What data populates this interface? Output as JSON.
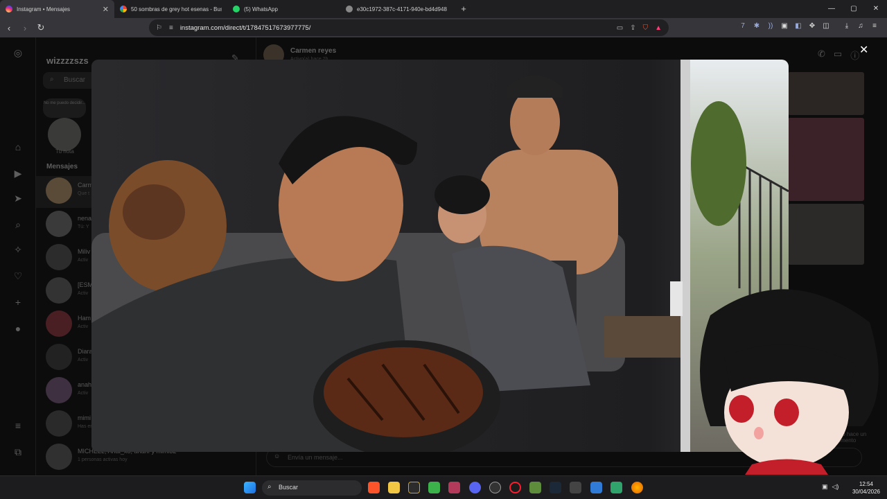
{
  "browser": {
    "tabs": [
      {
        "label": "Instagram • Mensajes",
        "icon": "instagram-icon",
        "active": true
      },
      {
        "label": "50 sombras de grey hot esenas - Bus",
        "icon": "google-icon"
      },
      {
        "label": "(5) WhatsApp",
        "icon": "whatsapp-icon"
      },
      {
        "label": "e30c1972-387c-4171-940e-bd4d948",
        "icon": "globe-icon"
      }
    ],
    "url": "instagram.com/direct/t/17847517673977775/"
  },
  "instagram": {
    "username": "wizzzzszs",
    "search_placeholder": "Buscar",
    "note_text": "No me puedo decidir...",
    "note_label": "Tu nota",
    "messages_header": "Mensajes",
    "conversations": [
      {
        "name": "Carm",
        "status": "Que t"
      },
      {
        "name": "nena",
        "status": "Tú: Y"
      },
      {
        "name": "Miliv",
        "status": "Activ"
      },
      {
        "name": "[ESM",
        "status": "Activ"
      },
      {
        "name": "Ham",
        "status": "Activ"
      },
      {
        "name": "Diara",
        "status": "Activ"
      },
      {
        "name": "anah",
        "status": "Activ"
      },
      {
        "name": "mimi",
        "status": "Has en"
      },
      {
        "name": "MICHELL, Anat_xo, anahí y mimi32",
        "status": "1 personas activas hoy"
      }
    ],
    "chat": {
      "contact_name": "Carmen reyes",
      "contact_status": "Activo(a) hace 2h",
      "seen_label": "Visto hace un momento",
      "input_placeholder": "Envía un mensaje..."
    }
  },
  "taskbar": {
    "search_label": "Buscar",
    "time": "12:54",
    "date": "30/04/2026"
  },
  "colors": {
    "instagram_accent": "#d62976",
    "browser_bg": "#1f1f22",
    "omnibox_bg": "#202023"
  }
}
